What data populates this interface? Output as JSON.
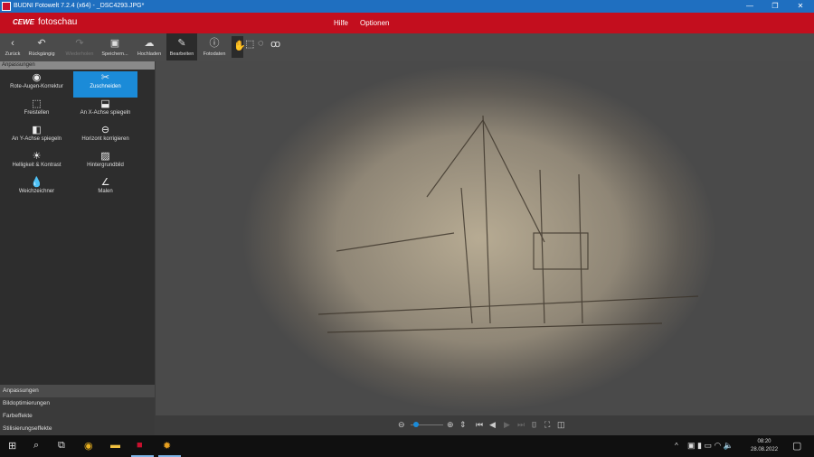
{
  "window": {
    "title": "BUDNI Fotowelt 7.2.4 (x64) - _DSC4293.JPG*",
    "minimize": "—",
    "maximize": "❐",
    "close": "✕"
  },
  "brand": {
    "logo_mark": "CEWE",
    "logo_text": "fotoschau",
    "menu": [
      "Hilfe",
      "Optionen"
    ]
  },
  "toolbar": {
    "back": "Zurück",
    "undo": "Rückgängig",
    "redo": "Wiederholen",
    "save": "Speichern...",
    "upload": "Hochladen",
    "edit": "Bearbeiten",
    "info": "Fotodaten"
  },
  "sidebar": {
    "header": "Anpassungen",
    "tools": [
      {
        "label": "Rote-Augen-Korrektur",
        "icon": "◉"
      },
      {
        "label": "Zuschneiden",
        "icon": "✂"
      },
      {
        "label": "Freistellen",
        "icon": "⬚"
      },
      {
        "label": "An X-Achse spiegeln",
        "icon": "⬓"
      },
      {
        "label": "An Y-Achse spiegeln",
        "icon": "◧"
      },
      {
        "label": "Horizont korrigieren",
        "icon": "⊖"
      },
      {
        "label": "Helligkeit & Kontrast",
        "icon": "☀"
      },
      {
        "label": "Hintergrundbild",
        "icon": "▨"
      },
      {
        "label": "Weichzeichner",
        "icon": "💧"
      },
      {
        "label": "Malen",
        "icon": "∠"
      }
    ],
    "sections": [
      "Anpassungen",
      "Bildoptimierungen",
      "Farbeffekte",
      "Stilisierungseffekte"
    ]
  },
  "zoom": {
    "value": 0.05
  },
  "taskbar": {
    "time": "08:20",
    "date": "28.08.2022"
  }
}
